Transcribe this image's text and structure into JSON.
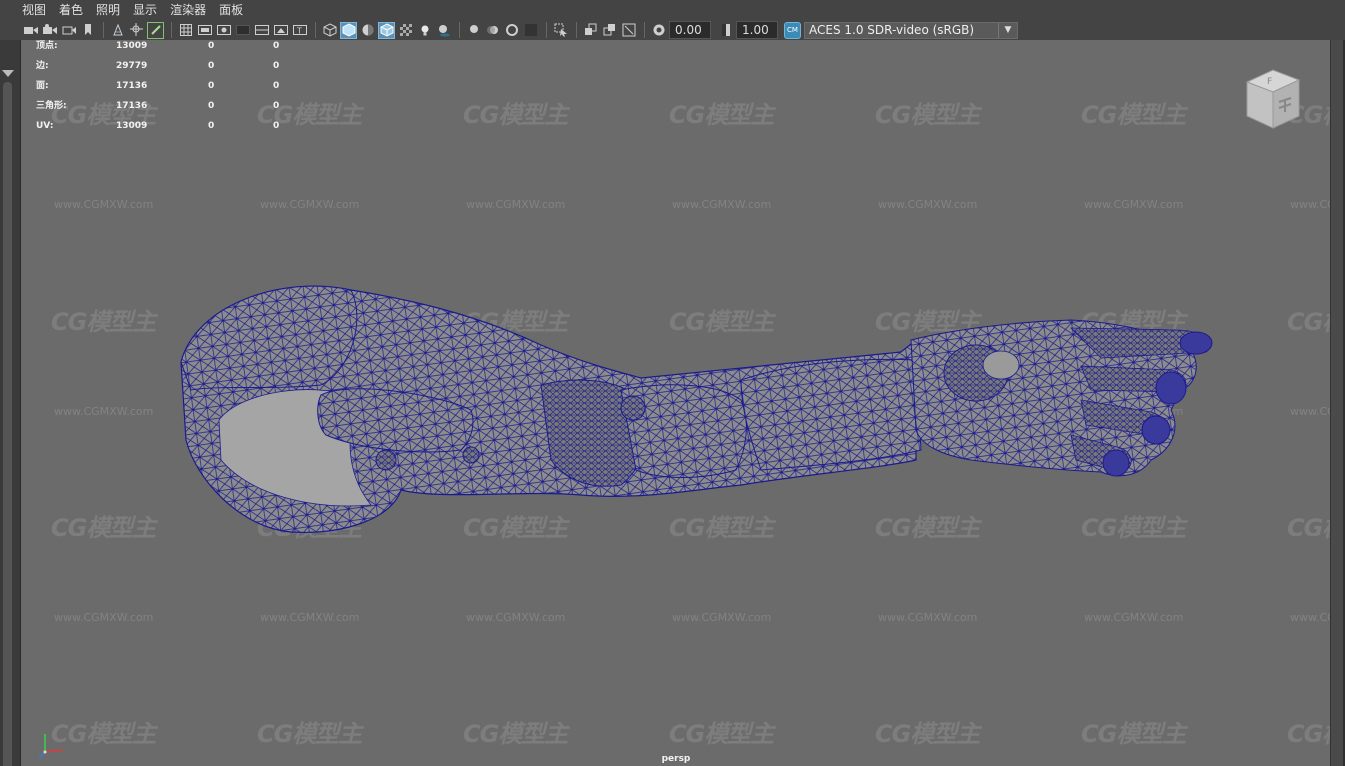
{
  "menu": {
    "items": [
      "视图",
      "着色",
      "照明",
      "显示",
      "渲染器",
      "面板"
    ]
  },
  "toolbar": {
    "exposure_value": "0.00",
    "gamma_value": "1.00",
    "color_management_icon": "cm-toggle-icon",
    "colorspace_value": "ACES 1.0 SDR-video (sRGB)",
    "icons": [
      "camera-select-icon",
      "camera-attributes-icon",
      "bookmark-icon",
      "image-plane-icon",
      "2d-pan-zoom-icon",
      "grease-pencil-icon",
      "grid-icon",
      "film-gate-icon",
      "resolution-gate-icon",
      "gate-mask-icon",
      "field-chart-icon",
      "safe-action-icon",
      "safe-title-icon",
      "wireframe-icon",
      "smooth-shade-icon",
      "default-material-icon",
      "wireframe-on-shaded-icon",
      "xray-icon",
      "use-all-lights-icon",
      "shadows-icon",
      "screen-space-ao-icon",
      "motion-blur-icon",
      "anti-aliasing-icon",
      "depth-of-field-icon",
      "isolate-select-icon",
      "xray-joints-icon",
      "xray-active-icon",
      "backface-culling-icon"
    ]
  },
  "hud": {
    "rows": [
      {
        "label": "顶点:",
        "v1": "13009",
        "v2": "0",
        "v3": "0"
      },
      {
        "label": "边:",
        "v1": "29779",
        "v2": "0",
        "v3": "0"
      },
      {
        "label": "面:",
        "v1": "17136",
        "v2": "0",
        "v3": "0"
      },
      {
        "label": "三角形:",
        "v1": "17136",
        "v2": "0",
        "v3": "0"
      },
      {
        "label": "UV:",
        "v1": "13009",
        "v2": "0",
        "v3": "0"
      }
    ]
  },
  "viewport": {
    "camera_label": "persp",
    "viewcube_face": "F",
    "background_color": "#6b6b6b",
    "wire_color": "#1a1a8c",
    "mesh_color": "#8a8a8a"
  },
  "watermark": {
    "logo_text": "CG模型主",
    "url_text": "www.CGMXW.com"
  }
}
